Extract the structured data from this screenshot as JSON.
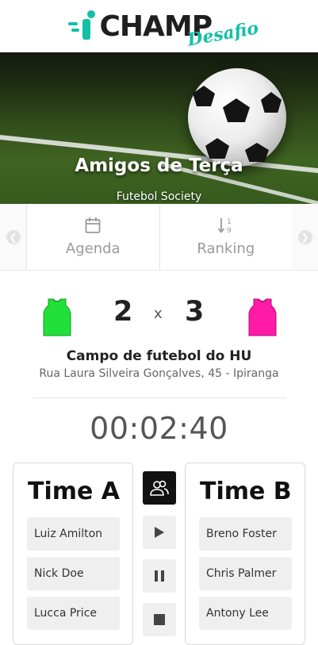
{
  "brand": {
    "logo_text": "CHAMP",
    "logo_script": "Desafio"
  },
  "hero": {
    "title": "Amigos de Terça",
    "subtitle": "Futebol Society"
  },
  "tabs": [
    {
      "label": "Agenda",
      "icon": "calendar-icon"
    },
    {
      "label": "Ranking",
      "icon": "sort-numeric-icon"
    }
  ],
  "match": {
    "score_a": "2",
    "separator": "x",
    "score_b": "3",
    "team_a_color": "#22e03a",
    "team_b_color": "#ff1aa8",
    "venue": "Campo de futebol do HU",
    "address": "Rua Laura Silveira Gonçalves, 45 - Ipiranga",
    "timer": "00:02:40"
  },
  "team_a": {
    "name": "Time A",
    "players": [
      "Luiz Amilton",
      "Nick Doe",
      "Lucca Price"
    ]
  },
  "team_b": {
    "name": "Time B",
    "players": [
      "Breno Foster",
      "Chris Palmer",
      "Antony Lee"
    ]
  },
  "controls": [
    "players-icon",
    "play-icon",
    "pause-icon",
    "stop-icon"
  ]
}
